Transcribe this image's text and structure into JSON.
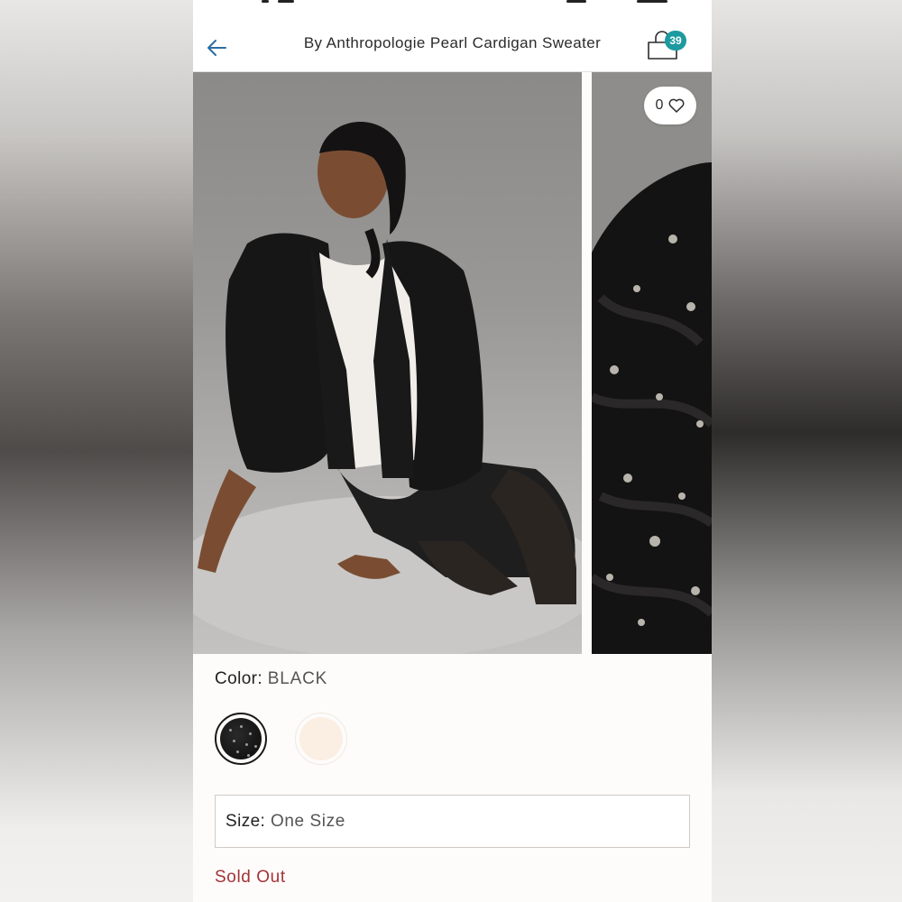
{
  "header": {
    "title": "By Anthropologie Pearl Cardigan Sweater",
    "cart_count": "39"
  },
  "gallery": {
    "favorite_count": "0"
  },
  "product": {
    "color_label": "Color:",
    "color_value": "BLACK",
    "swatches": [
      {
        "name": "black",
        "color": "#111111",
        "selected": true
      },
      {
        "name": "ivory",
        "color": "#fbeee2",
        "selected": false
      }
    ],
    "size_label": "Size:",
    "size_value": "One Size",
    "availability": "Sold Out"
  },
  "colors": {
    "accent": "#1c9aa0",
    "back_arrow": "#2b6ea4",
    "sold_out": "#a3333a"
  },
  "icons": [
    "back-arrow-icon",
    "shopping-bag-icon",
    "heart-icon"
  ]
}
